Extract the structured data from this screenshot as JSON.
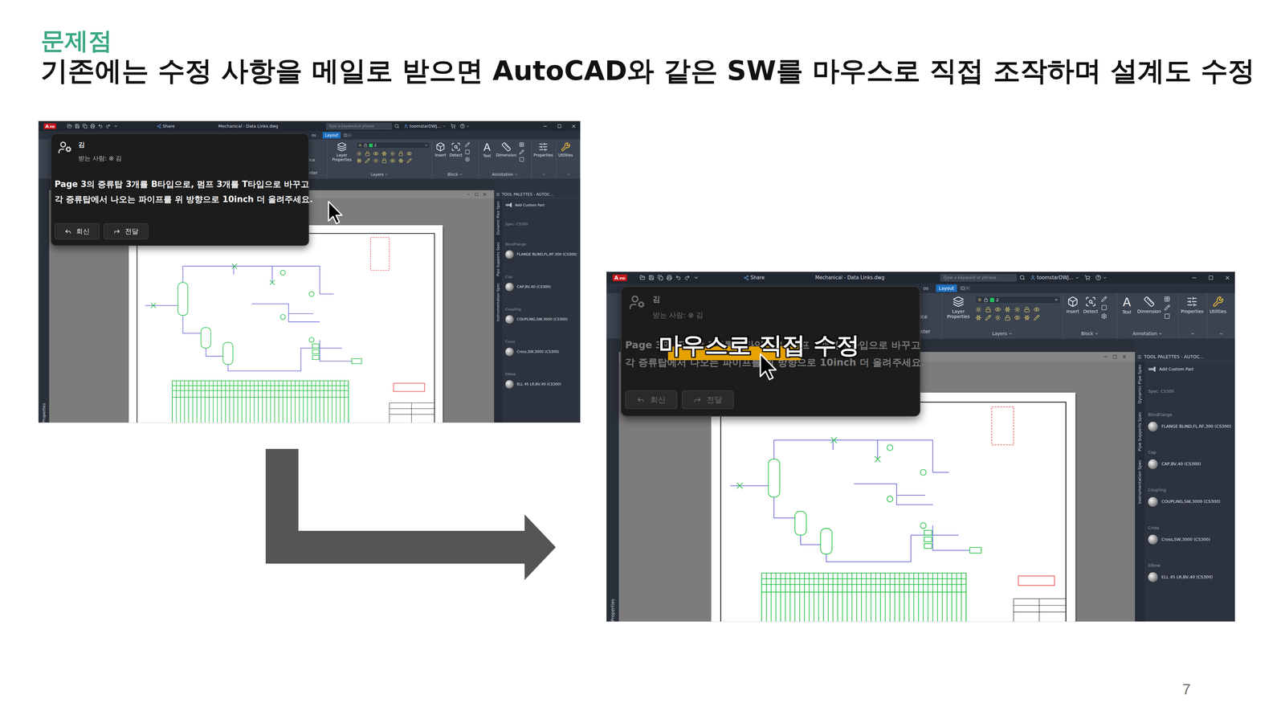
{
  "slide": {
    "heading": "문제점",
    "title": "기존에는 수정 사항을 메일로 받으면 AutoCAD와 같은 SW를 마우스로 직접 조작하며 설계도 수정",
    "page_number": "7"
  },
  "cad_window": {
    "app_badge": "A",
    "app_badge_sub": "PID",
    "share": "Share",
    "title": "Mechanical - Data Links.dwg",
    "search_placeholder": "Type a keyword or phrase",
    "user": "toomstarDWJ...",
    "ribbon": {
      "tabs": [
        {
          "label": "os",
          "selected": false
        },
        {
          "label": "Layout",
          "selected": true
        }
      ],
      "fragments": [
        "ice",
        "nter"
      ],
      "layer_combo_value": "2",
      "panels": [
        {
          "title": "Layers",
          "kind": "layers",
          "buttons": [
            {
              "label": "Layer Properties"
            }
          ]
        },
        {
          "title": "Block",
          "kind": "tools",
          "buttons": [
            {
              "label": "Insert"
            },
            {
              "label": "Detect"
            }
          ]
        },
        {
          "title": "Annotation",
          "kind": "tools",
          "buttons": [
            {
              "label": "Text",
              "glyph": "A"
            },
            {
              "label": "Dimension"
            }
          ]
        },
        {
          "kind": "single",
          "buttons": [
            {
              "label": "Properties"
            }
          ]
        },
        {
          "kind": "single",
          "buttons": [
            {
              "label": "Utilities"
            }
          ]
        }
      ]
    },
    "left_palette": "Properties",
    "tool_palette": {
      "title": "TOOL PALETTES - AUTOC...",
      "tabs": [
        "Dynamic Pipe Spec",
        "Pipe Supports Spec",
        "Instrumentation Spec"
      ],
      "add_part": "Add Custom Part",
      "spec": "Spec: CS300",
      "groups": [
        {
          "name": "BlindFlange",
          "item": "FLANGE BLIND,FL,RF,300 (CS300)"
        },
        {
          "name": "Cap",
          "item": "CAP,BV,40 (CS300)"
        },
        {
          "name": "Coupling",
          "item": "COUPLING,SW,3000 (CS300)"
        },
        {
          "name": "Cross",
          "item": "Cross,SW,3000 (CS300)"
        },
        {
          "name": "Elbow",
          "item": "ELL 45 LR,BV,40 (CS300)"
        }
      ]
    }
  },
  "mail_popup": {
    "sender": "김",
    "recipient_label": "받는 사람:",
    "recipient_icon": "⊗",
    "recipient": "김",
    "message_lines": [
      "Page 3의 증류탑 3개를 B타입으로, 펌프 3개를 T타입으로 바꾸고",
      "각 증류탑에서 나오는 파이프를 위 방향으로 10inch 더 올려주세요."
    ],
    "buttons": [
      "회신",
      "전달"
    ]
  },
  "before_screenshot": {
    "popup_dimmed": false
  },
  "after_screenshot": {
    "popup_dimmed": true,
    "caption": "마우스로 직접 수정"
  }
}
